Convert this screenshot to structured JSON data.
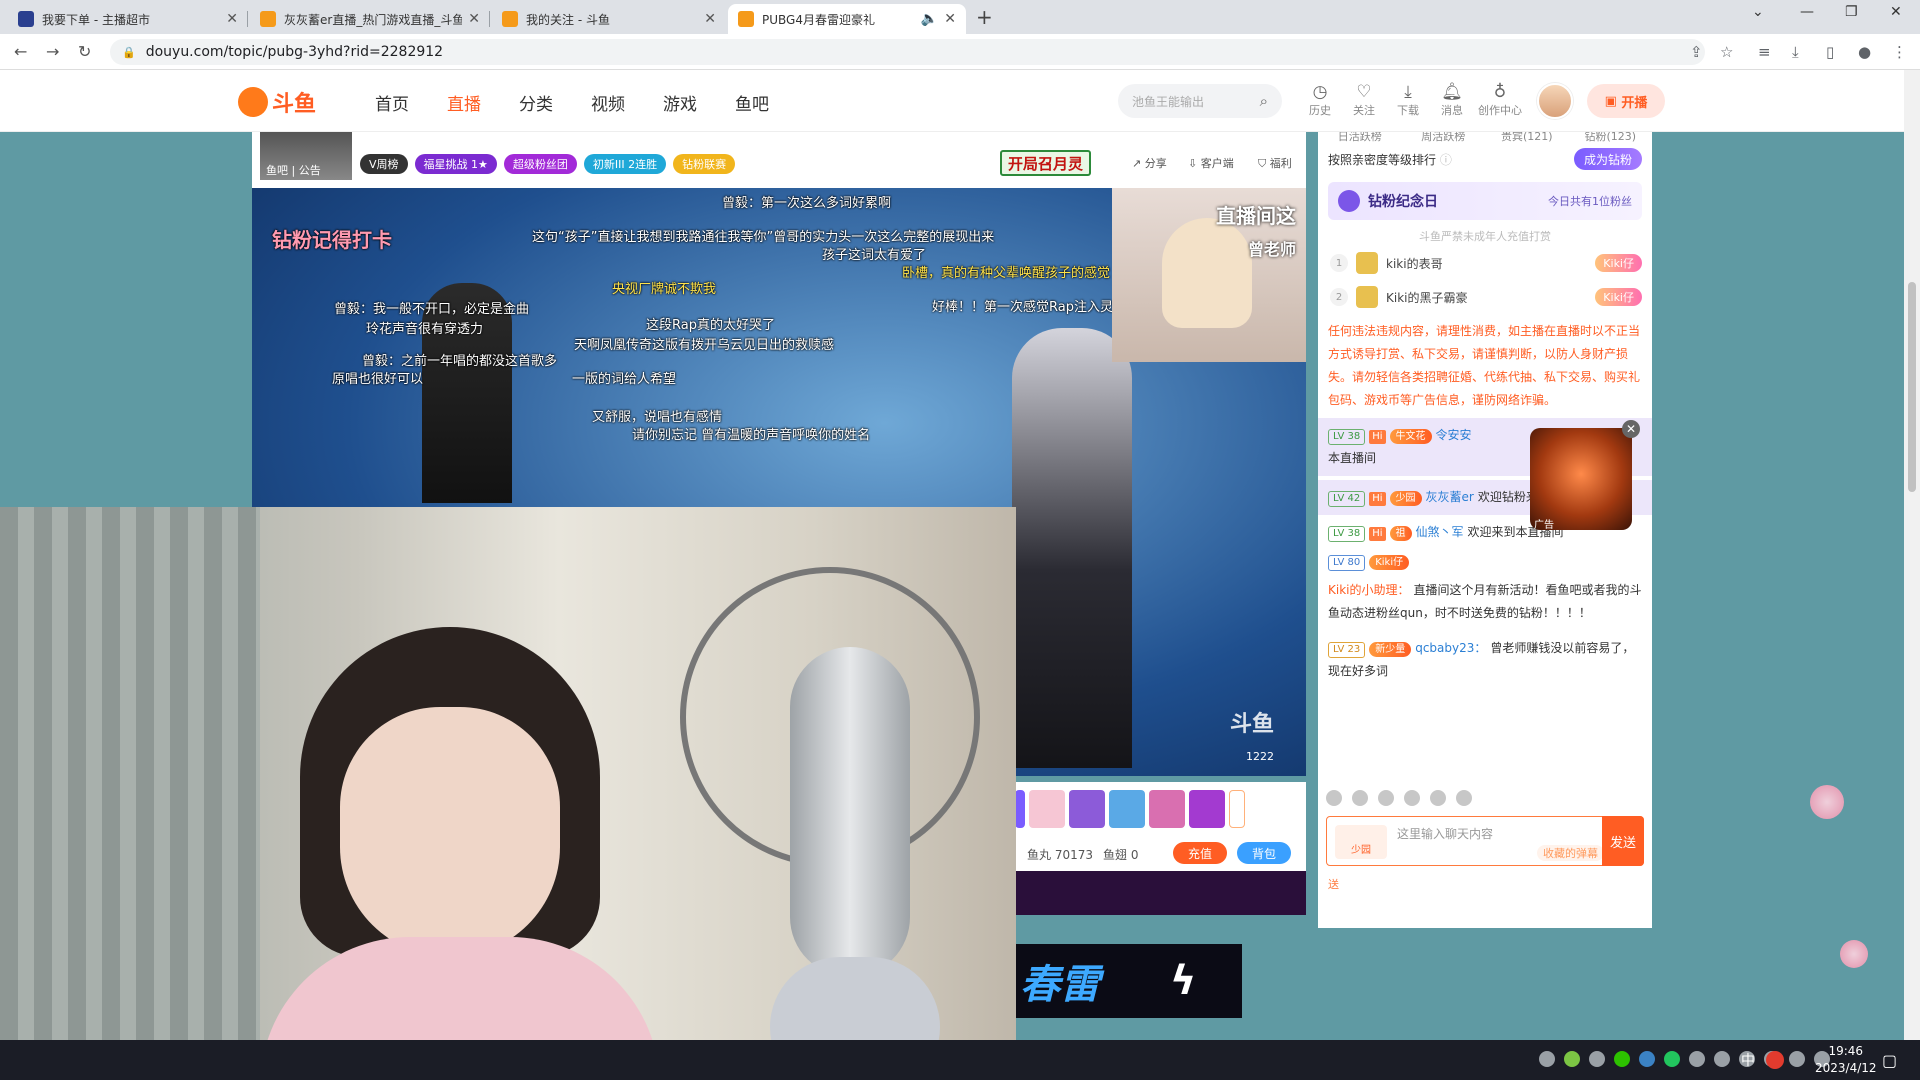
{
  "browser": {
    "tabs": [
      {
        "title": "我要下单 - 主播超市",
        "fav_color": "#2a3f8f"
      },
      {
        "title": "灰灰蓄er直播_热门游戏直播_斗鱼",
        "fav_color": "#f59a1a"
      },
      {
        "title": "我的关注 - 斗鱼",
        "fav_color": "#f59a1a"
      },
      {
        "title": "PUBG4月春雷迎豪礼",
        "fav_color": "#f59a1a"
      }
    ],
    "url": "douyu.com/topic/pubg-3yhd?rid=2282912"
  },
  "site": {
    "logo_text": "斗鱼",
    "nav": [
      "首页",
      "直播",
      "分类",
      "视频",
      "游戏",
      "鱼吧"
    ],
    "search_placeholder": "池鱼王能输出",
    "header_icons": [
      {
        "icon": "history-icon",
        "label": "历史"
      },
      {
        "icon": "heart-icon",
        "label": "关注"
      },
      {
        "icon": "download-icon",
        "label": "下载"
      },
      {
        "icon": "bell-icon",
        "label": "消息"
      },
      {
        "icon": "bulb-icon",
        "label": "创作中心"
      }
    ],
    "golive_label": "开播"
  },
  "stream": {
    "anchor_labels": [
      "鱼吧",
      "公告"
    ],
    "tags": [
      {
        "text": "V周榜",
        "color": "#333"
      },
      {
        "text": "福星挑战 1★",
        "color": "#7b2bd1"
      },
      {
        "text": "超级粉丝团",
        "color": "#a22ad8"
      },
      {
        "text": "初新III 2连胜",
        "color": "#1fa8d8"
      },
      {
        "text": "钻粉联赛",
        "color": "#f1b51c"
      }
    ],
    "kaiju_badge": "开局召月灵",
    "actions": [
      "分享",
      "客户端",
      "福利"
    ],
    "danmaku": [
      "曾毅：第一次这么多词好累啊",
      "这句“孩子”直接让我想到我路通往我等你”曾哥的实力头一次这么完整的展现出来",
      "孩子这词太有爱了",
      "央视厂牌诚不欺我",
      "曾毅：我一般不开口，必定是金曲",
      "玲花声音很有穿透力",
      "这段Rap真的太好哭了",
      "天啊凤凰传奇这版有拨开乌云见日出的救赎感",
      "曾毅：之前一年唱的都没这首歌多",
      "原唱也很好可以",
      "一版的词给人希望",
      "又舒服，说唱也有感情",
      "请你别忘记 曾有温暖的声音呼唤你的姓名",
      "卧槽，真的有种父辈唤醒孩子的感觉",
      "好棒！！第一次感觉Rap注入灵魂",
      "钻粉记得打卡"
    ],
    "pip_title": "直播间这",
    "pip_sub": "曾老师",
    "room_watermark": "斗鱼",
    "room_no": "1222"
  },
  "gift_panel": {
    "fishball": "鱼丸 70173",
    "fishcoin": "鱼翅 0",
    "recharge": "充值",
    "backpack": "背包"
  },
  "chat": {
    "tabs": [
      "日活跃榜",
      "周活跃榜",
      "贵宾(121)",
      "钻粉(123)"
    ],
    "rank_hint": "按照亲密度等级排行",
    "become_fan": "成为钻粉",
    "anniv_title": "钻粉纪念日",
    "anniv_right": "今日共有1位粉丝",
    "minor_notice": "斗鱼严禁未成年人充值打赏",
    "rank": [
      {
        "n": "1",
        "name": "kiki的表哥",
        "fan": "Kiki仔"
      },
      {
        "n": "2",
        "name": "Kiki的黑子霸豪",
        "fan": "Kiki仔"
      }
    ],
    "warning": "任何违法违规内容，请理性消费，如主播在直播时以不正当方式诱导打赏、私下交易，请谨慎判断，以防人身财产损失。请勿轻信各类招聘征婚、代练代抽、私下交易、购买礼包码、游戏币等广告信息，谨防网络诈骗。",
    "messages": [
      {
        "lv": "LV 38",
        "badge": "牛文花",
        "user": "令安安",
        "text": "本直播间",
        "hl": true
      },
      {
        "lv": "LV 42",
        "badge": "少园",
        "user": "灰灰蓄er",
        "text": "欢迎钻粉来到本直播间",
        "hl": true
      },
      {
        "lv": "LV 38",
        "badge": "祖",
        "user": "仙煞丶军",
        "text": "欢迎来到本直播间",
        "hl": false
      },
      {
        "lv": "LV 80",
        "badge": "Kiki仔",
        "user": "",
        "text": "",
        "hl": false
      },
      {
        "lv": "",
        "badge": "",
        "user": "Kiki的小助理：",
        "text": "直播间这个月有新活动！看鱼吧或者我的斗鱼动态进粉丝qun，时不时送免费的钻粉！！！！",
        "hl": false
      },
      {
        "lv": "LV 23",
        "badge": "新少量",
        "user": "qcbaby23：",
        "text": "曾老师赚钱没以前容易了，现在好多词",
        "hl": false
      }
    ],
    "ad_label": "广告",
    "input_placeholder": "这里输入聊天内容",
    "input_level": "少园",
    "dm_hint": "收藏的弹幕",
    "send": "发送",
    "footer": "送"
  },
  "banner": {
    "text": "春雷",
    "bolt": "ϟ"
  },
  "system": {
    "ime": "中",
    "time": "19:46",
    "date": "2023/4/12"
  },
  "colors": {
    "brand": "#ff5d23",
    "accent_purple": "#7b56e8"
  }
}
